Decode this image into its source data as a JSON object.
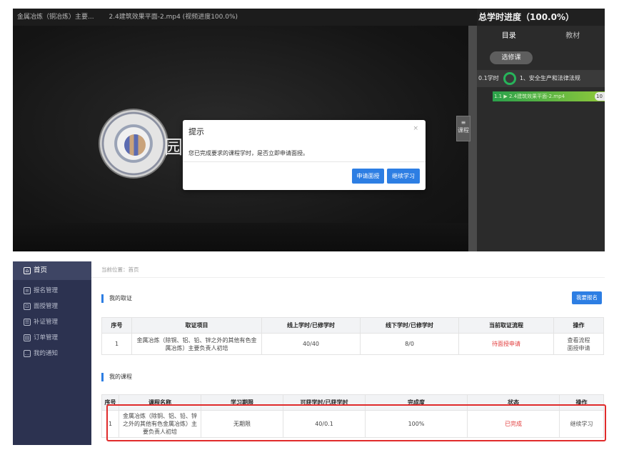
{
  "player": {
    "title_course": "金属冶炼（铜冶炼）主要...",
    "title_file": "2.4建筑效果平面-2.mp4 (视频进度100.0%)",
    "watermark_text": "园",
    "toggle_icon": "menu-lines-icon",
    "toggle_label": "课程"
  },
  "right_panel": {
    "progress_title": "总学时进度（100.0%）",
    "tabs": [
      "目录",
      "教材"
    ],
    "elective_label": "选修课",
    "chapter_hours": "0.1学时",
    "chapter_title": "1、安全生产和法律法规",
    "lesson_title": "1.1 ▶ 2.4建筑效果平面-2.mp4",
    "lesson_badge": "10",
    "colors": {
      "progress_ring": "#27b45a",
      "lesson_bar": "#2aa14b"
    }
  },
  "modal": {
    "title": "提示",
    "close": "×",
    "message": "您已完成要求的课程学时，是否立即申请面授。",
    "apply_button": "申请面授",
    "continue_button": "继续学习",
    "accent": "#2d7ee3"
  },
  "sidebar": {
    "items": [
      {
        "label": "首页",
        "icon": "home-icon",
        "active": true
      },
      {
        "label": "报名管理",
        "icon": "list-icon"
      },
      {
        "label": "面授管理",
        "icon": "class-icon"
      },
      {
        "label": "补证管理",
        "icon": "certificate-icon"
      },
      {
        "label": "订单管理",
        "icon": "order-icon"
      },
      {
        "label": "我的通知",
        "icon": "message-icon"
      }
    ]
  },
  "main": {
    "breadcrumb": "当前位置：首页",
    "cert_section_title": "我的取证",
    "apply_button": "我要报名",
    "cert_table": {
      "headers": [
        "序号",
        "取证项目",
        "线上学时/已修学时",
        "线下学时/已修学时",
        "当前取证流程",
        "操作"
      ],
      "rows": [
        {
          "index": "1",
          "project": "金属冶炼（除铜、铝、铅、锌之外的其他有色金属冶炼）主要负责人初培",
          "online": "40/40",
          "offline": "8/0",
          "status": "待面授申请",
          "action1": "查看流程",
          "action2": "面授申请"
        }
      ]
    },
    "course_section_title": "我的课程",
    "course_table": {
      "headers": [
        "序号",
        "课程名称",
        "学习期限",
        "可获学时/已获学时",
        "完成度",
        "状态",
        "操作"
      ],
      "rows": [
        {
          "index": "1",
          "name": "金属冶炼（除铜、铝、铅、锌之外的其他有色金属冶炼）主要负责人初培",
          "period": "无期限",
          "hours": "40/0.1",
          "completion": "100%",
          "status": "已完成",
          "action": "继续学习"
        }
      ]
    },
    "colors": {
      "status_red": "#e23c3c",
      "highlight_border": "#e02b2b",
      "sidebar_bg": "#2c3250"
    }
  }
}
